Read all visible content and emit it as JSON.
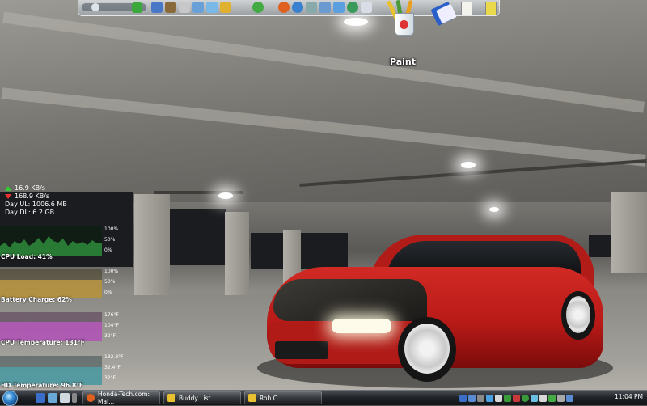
{
  "desktop": {
    "icons": [
      {
        "name": "paint",
        "label": "Paint"
      }
    ]
  },
  "gadgets": {
    "network": {
      "upload_rate": "16.9 KB/s",
      "download_rate": "168.9 KB/s",
      "day_upload": "Day UL: 1006.6 MB",
      "day_download": "Day DL: 6.2 GB"
    },
    "cpu": {
      "label": "CPU Load: 41%",
      "level": 0.41,
      "scale": [
        "100%",
        "50%",
        "0%"
      ]
    },
    "battery": {
      "label": "Battery Charge: 62%",
      "level": 0.62,
      "scale": [
        "100%",
        "50%",
        "0%"
      ]
    },
    "cpu_temp": {
      "label": "CPU Temperature: 131°F",
      "scale": [
        "176°F",
        "104°F",
        "32°F"
      ]
    },
    "hd_temp": {
      "label": "HD Temperature: 96.8°F",
      "scale": [
        "132.8°F",
        "32.4°F",
        "32°F"
      ]
    }
  },
  "taskbar": {
    "buttons": [
      {
        "label": "Honda-Tech.com: Mai...",
        "icon": "firefox-icon"
      },
      {
        "label": "Buddy List",
        "icon": "buddy-icon"
      },
      {
        "label": "Rob C",
        "icon": "chat-icon"
      }
    ],
    "clock": "11:04 PM"
  },
  "colors": {
    "cpu_graph": "#2e8b3a",
    "battery_graph": "#c9a040",
    "cpu_temp_graph": "#c05ac8",
    "hd_temp_graph": "#4aa8b0",
    "car": "#c81f1c"
  }
}
